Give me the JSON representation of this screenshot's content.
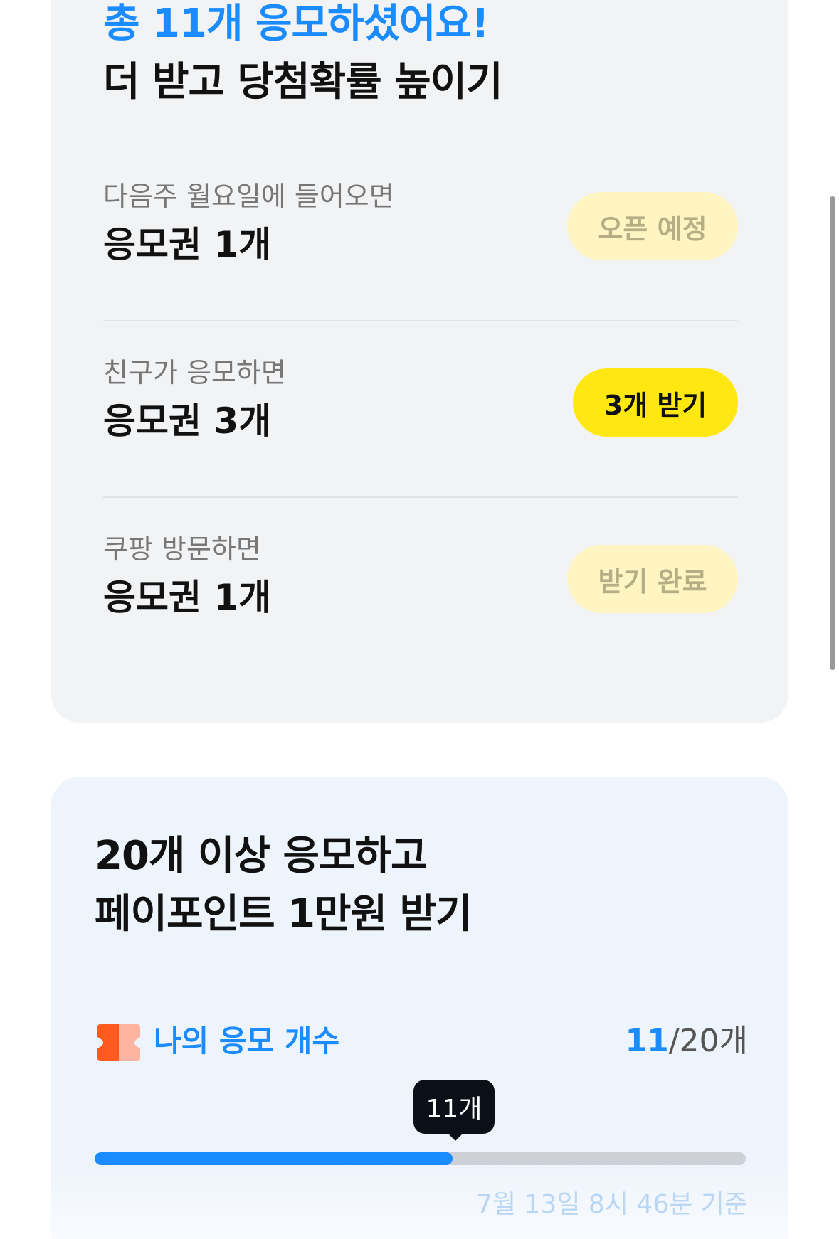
{
  "summary": {
    "total_entries_text": "총 11개 응모하셨어요!",
    "subtitle": "더 받고 당첨확률 높이기"
  },
  "tasks": [
    {
      "condition": "다음주 월요일에 들어오면",
      "reward": "응모권 1개",
      "button": "오픈 예정",
      "state": "pending"
    },
    {
      "condition": "친구가 응모하면",
      "reward": "응모권 3개",
      "button": "3개 받기",
      "state": "active"
    },
    {
      "condition": "쿠팡 방문하면",
      "reward": "응모권 1개",
      "button": "받기 완료",
      "state": "done"
    }
  ],
  "promo": {
    "line1": "20개 이상 응모하고",
    "line2": "페이포인트 1만원 받기"
  },
  "progress": {
    "label": "나의 응모 개수",
    "current": "11",
    "total_text": "/20개",
    "tooltip": "11개",
    "fraction": 0.55,
    "timestamp": "7월 13일 8시 46분 기준"
  },
  "colors": {
    "accent_blue": "#1a8cff",
    "accent_yellow": "#ffe812",
    "pale_yellow": "#fff5c2",
    "ticket_orange": "#ff5a1f"
  },
  "icons": {
    "ticket": "ticket-icon"
  }
}
